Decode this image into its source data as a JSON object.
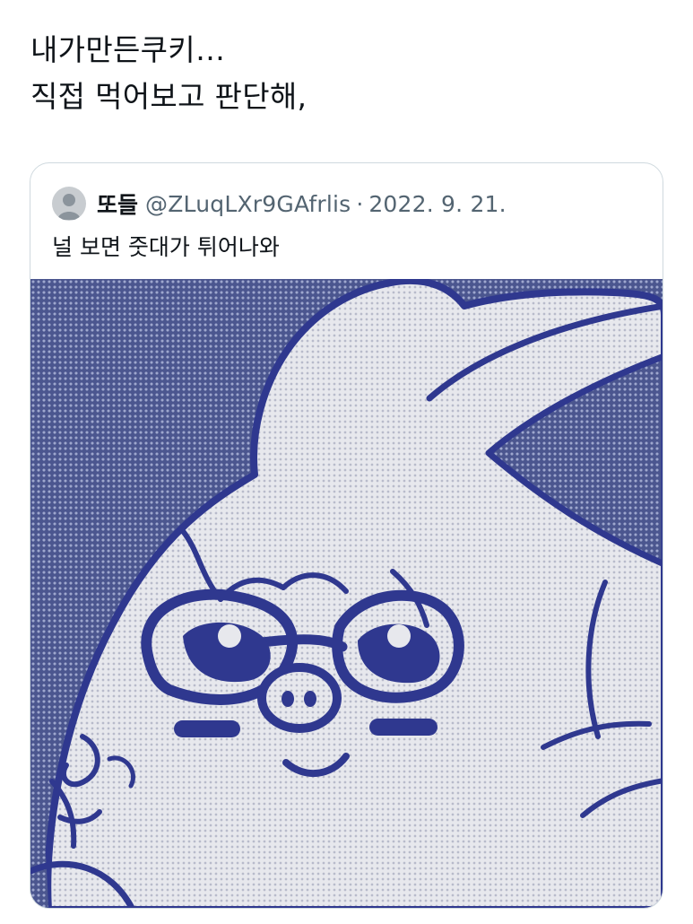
{
  "tweet": {
    "text_lines": [
      "내가만든쿠키…",
      "직접 먹어보고 판단해,"
    ]
  },
  "quote": {
    "display_name": "또들",
    "handle": "@ZLuqLXr9GAfrlis",
    "separator": "·",
    "date": "2022. 9. 21.",
    "text": "널 보면 줏대가 튀어나와",
    "avatar_icon": "default-user-avatar-icon",
    "media_icon": "rabbit-character-illustration"
  },
  "colors": {
    "background": "#ffffff",
    "text": "#0f1419",
    "muted": "#536471",
    "border": "#cfd9de",
    "illustration_blue": "#3f4a97",
    "illustration_light": "#e6e8ef"
  }
}
